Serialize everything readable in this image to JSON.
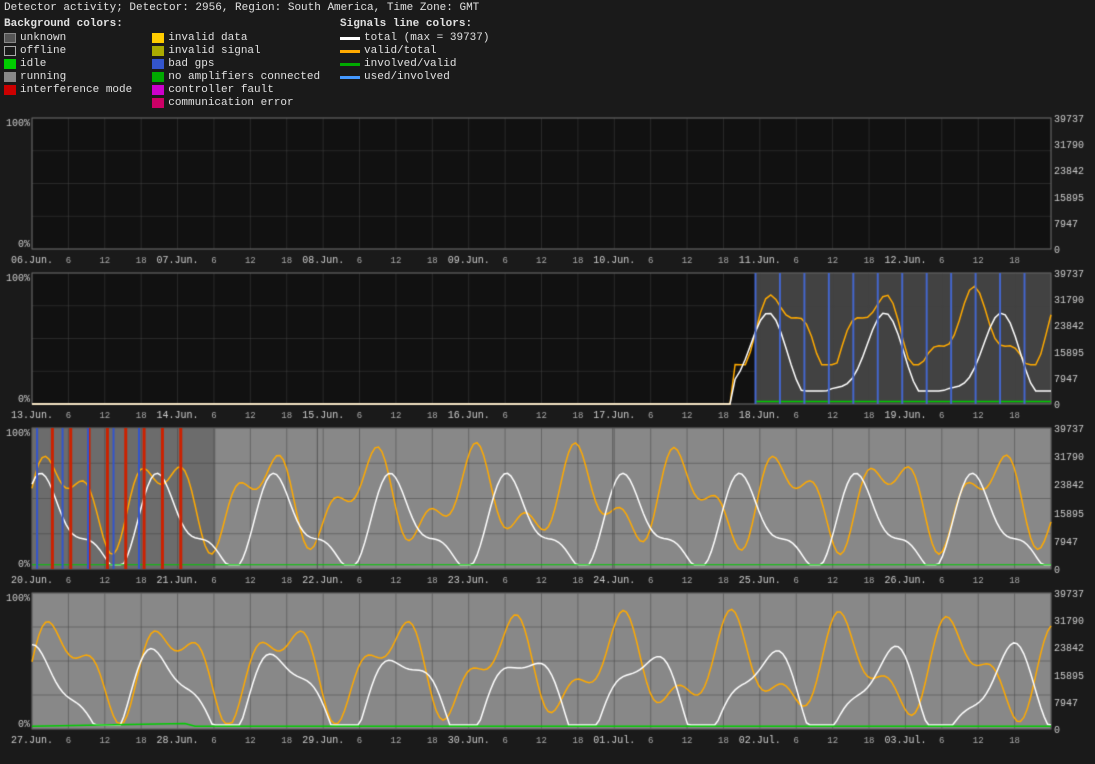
{
  "header": {
    "title": "Detector activity; Detector: 2956, Region: South America, Time Zone: GMT"
  },
  "legend": {
    "background_title": "Background colors:",
    "signals_title": "Signals line colors:",
    "bg_items": [
      {
        "label": "unknown",
        "color": "#555555"
      },
      {
        "label": "offline",
        "color": "#333333",
        "border": "#888888"
      },
      {
        "label": "idle",
        "color": "#00cc00"
      },
      {
        "label": "running",
        "color": "#888888"
      },
      {
        "label": "interference mode",
        "color": "#cc0000"
      }
    ],
    "invalid_items": [
      {
        "label": "invalid data",
        "color": "#ffcc00"
      },
      {
        "label": "invalid signal",
        "color": "#aaaa00"
      },
      {
        "label": "bad gps",
        "color": "#0000cc"
      },
      {
        "label": "no amplifiers connected",
        "color": "#00aa00"
      },
      {
        "label": "controller fault",
        "color": "#cc00cc"
      },
      {
        "label": "communication error",
        "color": "#cc0066"
      }
    ],
    "signal_items": [
      {
        "label": "total (max = 39737)",
        "color": "#ffffff"
      },
      {
        "label": "valid/total",
        "color": "#ffaa00"
      },
      {
        "label": "involved/valid",
        "color": "#00aa00"
      },
      {
        "label": "used/involved",
        "color": "#4499ff"
      }
    ]
  },
  "charts": [
    {
      "id": "chart1",
      "y_max_pct": "100%",
      "y_min_pct": "0%",
      "y_values": [
        39737,
        31790,
        23842,
        15895,
        7947,
        0
      ],
      "x_labels": [
        "06.Jun.",
        "07.Jun.",
        "08.Jun.",
        "09.Jun.",
        "10.Jun.",
        "11.Jun.",
        "12.Jun."
      ],
      "background": "dark_empty"
    },
    {
      "id": "chart2",
      "y_max_pct": "100%",
      "y_min_pct": "0%",
      "y_values": [
        39737,
        31790,
        23842,
        15895,
        7947,
        0
      ],
      "x_labels": [
        "13.Jun.",
        "14.Jun.",
        "15.Jun.",
        "16.Jun.",
        "17.Jun.",
        "18.Jun.",
        "19.Jun."
      ],
      "background": "mixed"
    },
    {
      "id": "chart3",
      "y_max_pct": "100%",
      "y_min_pct": "0%",
      "y_values": [
        39737,
        31790,
        23842,
        15895,
        7947,
        0
      ],
      "x_labels": [
        "20.Jun.",
        "21.Jun.",
        "22.Jun.",
        "23.Jun.",
        "24.Jun.",
        "25.Jun.",
        "26.Jun."
      ],
      "background": "active"
    },
    {
      "id": "chart4",
      "y_max_pct": "100%",
      "y_min_pct": "0%",
      "y_values": [
        39737,
        31790,
        23842,
        15895,
        7947,
        0
      ],
      "x_labels": [
        "27.Jun.",
        "28.Jun.",
        "29.Jun.",
        "30.Jun.",
        "01.Jul.",
        "02.Jul.",
        "03.Jul."
      ],
      "background": "active"
    }
  ]
}
